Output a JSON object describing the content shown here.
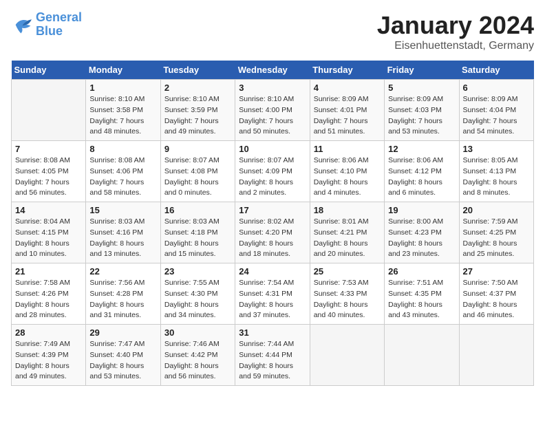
{
  "header": {
    "logo_line1": "General",
    "logo_line2": "Blue",
    "month": "January 2024",
    "location": "Eisenhuettenstadt, Germany"
  },
  "weekdays": [
    "Sunday",
    "Monday",
    "Tuesday",
    "Wednesday",
    "Thursday",
    "Friday",
    "Saturday"
  ],
  "weeks": [
    [
      {
        "day": "",
        "sunrise": "",
        "sunset": "",
        "daylight": ""
      },
      {
        "day": "1",
        "sunrise": "Sunrise: 8:10 AM",
        "sunset": "Sunset: 3:58 PM",
        "daylight": "Daylight: 7 hours and 48 minutes."
      },
      {
        "day": "2",
        "sunrise": "Sunrise: 8:10 AM",
        "sunset": "Sunset: 3:59 PM",
        "daylight": "Daylight: 7 hours and 49 minutes."
      },
      {
        "day": "3",
        "sunrise": "Sunrise: 8:10 AM",
        "sunset": "Sunset: 4:00 PM",
        "daylight": "Daylight: 7 hours and 50 minutes."
      },
      {
        "day": "4",
        "sunrise": "Sunrise: 8:09 AM",
        "sunset": "Sunset: 4:01 PM",
        "daylight": "Daylight: 7 hours and 51 minutes."
      },
      {
        "day": "5",
        "sunrise": "Sunrise: 8:09 AM",
        "sunset": "Sunset: 4:03 PM",
        "daylight": "Daylight: 7 hours and 53 minutes."
      },
      {
        "day": "6",
        "sunrise": "Sunrise: 8:09 AM",
        "sunset": "Sunset: 4:04 PM",
        "daylight": "Daylight: 7 hours and 54 minutes."
      }
    ],
    [
      {
        "day": "7",
        "sunrise": "Sunrise: 8:08 AM",
        "sunset": "Sunset: 4:05 PM",
        "daylight": "Daylight: 7 hours and 56 minutes."
      },
      {
        "day": "8",
        "sunrise": "Sunrise: 8:08 AM",
        "sunset": "Sunset: 4:06 PM",
        "daylight": "Daylight: 7 hours and 58 minutes."
      },
      {
        "day": "9",
        "sunrise": "Sunrise: 8:07 AM",
        "sunset": "Sunset: 4:08 PM",
        "daylight": "Daylight: 8 hours and 0 minutes."
      },
      {
        "day": "10",
        "sunrise": "Sunrise: 8:07 AM",
        "sunset": "Sunset: 4:09 PM",
        "daylight": "Daylight: 8 hours and 2 minutes."
      },
      {
        "day": "11",
        "sunrise": "Sunrise: 8:06 AM",
        "sunset": "Sunset: 4:10 PM",
        "daylight": "Daylight: 8 hours and 4 minutes."
      },
      {
        "day": "12",
        "sunrise": "Sunrise: 8:06 AM",
        "sunset": "Sunset: 4:12 PM",
        "daylight": "Daylight: 8 hours and 6 minutes."
      },
      {
        "day": "13",
        "sunrise": "Sunrise: 8:05 AM",
        "sunset": "Sunset: 4:13 PM",
        "daylight": "Daylight: 8 hours and 8 minutes."
      }
    ],
    [
      {
        "day": "14",
        "sunrise": "Sunrise: 8:04 AM",
        "sunset": "Sunset: 4:15 PM",
        "daylight": "Daylight: 8 hours and 10 minutes."
      },
      {
        "day": "15",
        "sunrise": "Sunrise: 8:03 AM",
        "sunset": "Sunset: 4:16 PM",
        "daylight": "Daylight: 8 hours and 13 minutes."
      },
      {
        "day": "16",
        "sunrise": "Sunrise: 8:03 AM",
        "sunset": "Sunset: 4:18 PM",
        "daylight": "Daylight: 8 hours and 15 minutes."
      },
      {
        "day": "17",
        "sunrise": "Sunrise: 8:02 AM",
        "sunset": "Sunset: 4:20 PM",
        "daylight": "Daylight: 8 hours and 18 minutes."
      },
      {
        "day": "18",
        "sunrise": "Sunrise: 8:01 AM",
        "sunset": "Sunset: 4:21 PM",
        "daylight": "Daylight: 8 hours and 20 minutes."
      },
      {
        "day": "19",
        "sunrise": "Sunrise: 8:00 AM",
        "sunset": "Sunset: 4:23 PM",
        "daylight": "Daylight: 8 hours and 23 minutes."
      },
      {
        "day": "20",
        "sunrise": "Sunrise: 7:59 AM",
        "sunset": "Sunset: 4:25 PM",
        "daylight": "Daylight: 8 hours and 25 minutes."
      }
    ],
    [
      {
        "day": "21",
        "sunrise": "Sunrise: 7:58 AM",
        "sunset": "Sunset: 4:26 PM",
        "daylight": "Daylight: 8 hours and 28 minutes."
      },
      {
        "day": "22",
        "sunrise": "Sunrise: 7:56 AM",
        "sunset": "Sunset: 4:28 PM",
        "daylight": "Daylight: 8 hours and 31 minutes."
      },
      {
        "day": "23",
        "sunrise": "Sunrise: 7:55 AM",
        "sunset": "Sunset: 4:30 PM",
        "daylight": "Daylight: 8 hours and 34 minutes."
      },
      {
        "day": "24",
        "sunrise": "Sunrise: 7:54 AM",
        "sunset": "Sunset: 4:31 PM",
        "daylight": "Daylight: 8 hours and 37 minutes."
      },
      {
        "day": "25",
        "sunrise": "Sunrise: 7:53 AM",
        "sunset": "Sunset: 4:33 PM",
        "daylight": "Daylight: 8 hours and 40 minutes."
      },
      {
        "day": "26",
        "sunrise": "Sunrise: 7:51 AM",
        "sunset": "Sunset: 4:35 PM",
        "daylight": "Daylight: 8 hours and 43 minutes."
      },
      {
        "day": "27",
        "sunrise": "Sunrise: 7:50 AM",
        "sunset": "Sunset: 4:37 PM",
        "daylight": "Daylight: 8 hours and 46 minutes."
      }
    ],
    [
      {
        "day": "28",
        "sunrise": "Sunrise: 7:49 AM",
        "sunset": "Sunset: 4:39 PM",
        "daylight": "Daylight: 8 hours and 49 minutes."
      },
      {
        "day": "29",
        "sunrise": "Sunrise: 7:47 AM",
        "sunset": "Sunset: 4:40 PM",
        "daylight": "Daylight: 8 hours and 53 minutes."
      },
      {
        "day": "30",
        "sunrise": "Sunrise: 7:46 AM",
        "sunset": "Sunset: 4:42 PM",
        "daylight": "Daylight: 8 hours and 56 minutes."
      },
      {
        "day": "31",
        "sunrise": "Sunrise: 7:44 AM",
        "sunset": "Sunset: 4:44 PM",
        "daylight": "Daylight: 8 hours and 59 minutes."
      },
      {
        "day": "",
        "sunrise": "",
        "sunset": "",
        "daylight": ""
      },
      {
        "day": "",
        "sunrise": "",
        "sunset": "",
        "daylight": ""
      },
      {
        "day": "",
        "sunrise": "",
        "sunset": "",
        "daylight": ""
      }
    ]
  ]
}
